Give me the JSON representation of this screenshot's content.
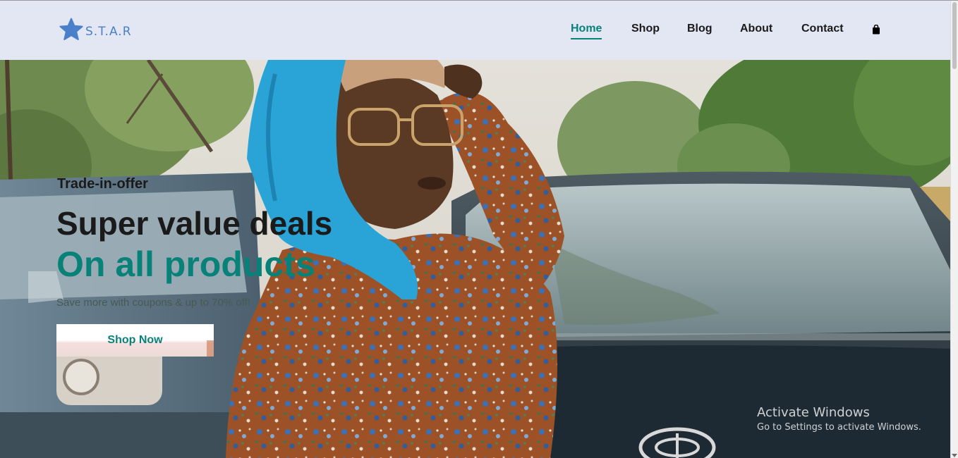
{
  "brand": {
    "name": "S.T.A.R",
    "color": "#4a7fc9"
  },
  "nav": {
    "items": [
      {
        "label": "Home",
        "active": true
      },
      {
        "label": "Shop",
        "active": false
      },
      {
        "label": "Blog",
        "active": false
      },
      {
        "label": "About",
        "active": false
      },
      {
        "label": "Contact",
        "active": false
      }
    ],
    "cart_icon": "shopping-bag-icon"
  },
  "hero": {
    "eyebrow": "Trade-in-offer",
    "headline": "Super value deals",
    "headline_accent": "On all products",
    "subtext": "Save more with coupons & up to 70% off!",
    "cta_label": "Shop Now",
    "accent_color": "#088178"
  },
  "os_watermark": {
    "title": "Activate Windows",
    "subtitle": "Go to Settings to activate Windows."
  }
}
